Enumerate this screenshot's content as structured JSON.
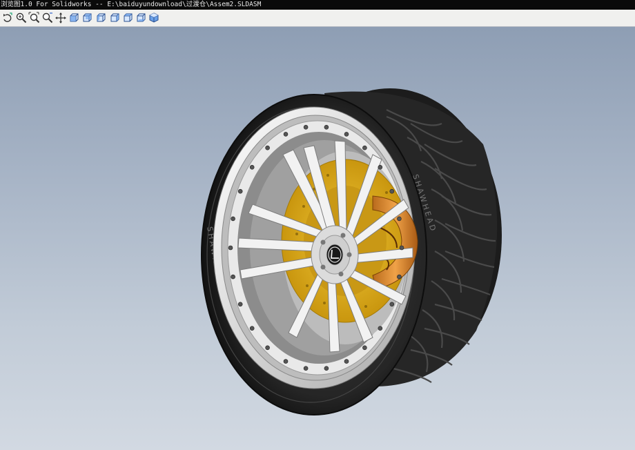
{
  "window": {
    "title": "浏览图1.0 For Solidworks -- E:\\baiduyundownload\\过渡仓\\Assem2.SLDASM"
  },
  "toolbar": {
    "buttons": [
      {
        "name": "rotate-view-button",
        "icon": "rotate-icon"
      },
      {
        "name": "zoom-button",
        "icon": "zoom-icon"
      },
      {
        "name": "zoom-to-fit-button",
        "icon": "zoom-fit-icon"
      },
      {
        "name": "zoom-area-button",
        "icon": "zoom-area-icon"
      },
      {
        "name": "pan-button",
        "icon": "pan-icon"
      },
      {
        "name": "front-view-button",
        "icon": "view-cube-front-icon"
      },
      {
        "name": "back-view-button",
        "icon": "view-cube-back-icon"
      },
      {
        "name": "left-view-button",
        "icon": "view-cube-left-icon"
      },
      {
        "name": "right-view-button",
        "icon": "view-cube-right-icon"
      },
      {
        "name": "top-view-button",
        "icon": "view-cube-top-icon"
      },
      {
        "name": "bottom-view-button",
        "icon": "view-cube-bottom-icon"
      },
      {
        "name": "isometric-view-button",
        "icon": "view-cube-iso-icon"
      }
    ]
  },
  "model": {
    "tire_sidewall_text": "SHAWHEAD",
    "colors": {
      "tire": "#2a2a2a",
      "rim": "#e8e8e8",
      "rotor": "#e0b020",
      "caliper": "#d88a2a",
      "background_top": "#8e9eb4",
      "background_bottom": "#d2d9e2"
    }
  }
}
